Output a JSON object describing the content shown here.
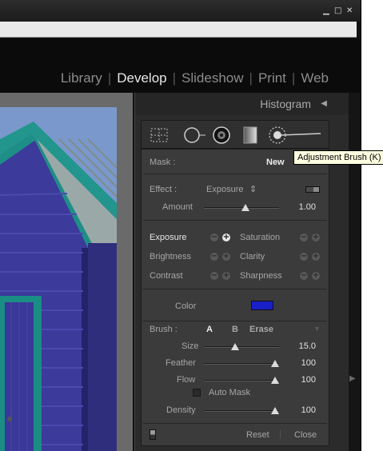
{
  "window": {
    "controls": {
      "minimize": "▁",
      "maximize": "□",
      "close": "✕"
    }
  },
  "module_picker": {
    "items": [
      {
        "label": "Library",
        "active": false
      },
      {
        "label": "Develop",
        "active": true
      },
      {
        "label": "Slideshow",
        "active": false
      },
      {
        "label": "Print",
        "active": false
      },
      {
        "label": "Web",
        "active": false
      }
    ],
    "separator": "|"
  },
  "panel": {
    "title": "Histogram",
    "collapse_arrow": "◀",
    "tools": [
      "crop-overlay-tool",
      "spot-removal-tool",
      "red-eye-tool",
      "graduated-filter-tool",
      "adjustment-brush-tool"
    ]
  },
  "tooltip": {
    "text": "Adjustment Brush (K)"
  },
  "mask": {
    "label": "Mask :",
    "value": "New"
  },
  "effect": {
    "label": "Effect :",
    "preset": "Exposure",
    "preset_arrow": "⇕",
    "amount_label": "Amount",
    "amount_value": "1.00",
    "amount_fraction": 0.55
  },
  "adjustments": {
    "left": [
      {
        "label": "Exposure",
        "highlighted": true,
        "plus_active": true
      },
      {
        "label": "Brightness",
        "highlighted": false,
        "plus_active": false
      },
      {
        "label": "Contrast",
        "highlighted": false,
        "plus_active": false
      }
    ],
    "right": [
      {
        "label": "Saturation"
      },
      {
        "label": "Clarity"
      },
      {
        "label": "Sharpness"
      }
    ],
    "minus_symbol": "−",
    "plus_symbol": "+"
  },
  "color": {
    "label": "Color",
    "swatch": "#1a20c8"
  },
  "brush": {
    "label": "Brush :",
    "option_a": "A",
    "option_b": "B",
    "option_erase": "Erase",
    "menu_arrow": "▼",
    "size": {
      "label": "Size",
      "value": "15.0",
      "fraction": 0.42
    },
    "feather": {
      "label": "Feather",
      "value": "100",
      "fraction": 0.95
    },
    "flow": {
      "label": "Flow",
      "value": "100",
      "fraction": 0.95
    },
    "auto_mask_label": "Auto Mask",
    "auto_mask_checked": false,
    "density": {
      "label": "Density",
      "value": "100",
      "fraction": 0.95
    }
  },
  "footer": {
    "reset_label": "Reset",
    "close_label": "Close",
    "separator": "|"
  },
  "colors": {
    "accent": "#1a20c8",
    "panel_bg": "#3b3b3b",
    "photo_sky": "#7a98cc",
    "hut_blue": "#3c3a9a",
    "trim_teal": "#1e8f86"
  }
}
